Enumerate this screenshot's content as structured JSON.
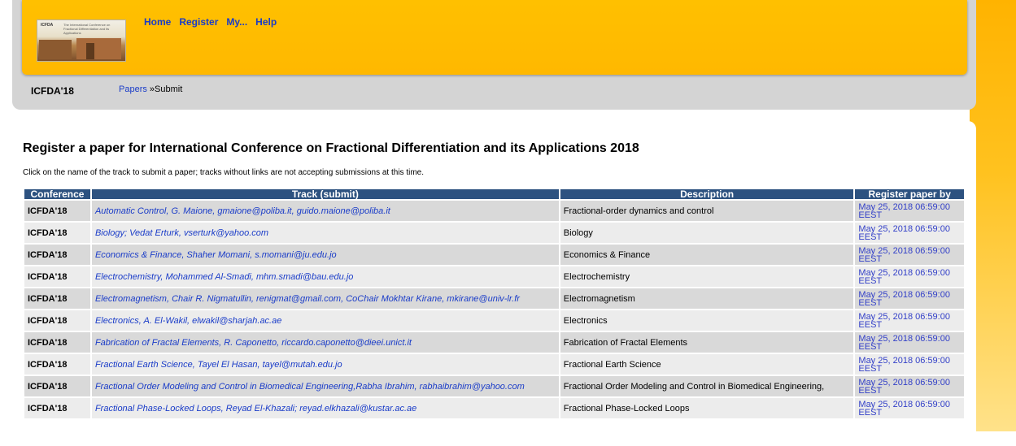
{
  "nav": {
    "items": [
      "Home",
      "Register",
      "My...",
      "Help"
    ]
  },
  "logo": {
    "mini_text": "ICFDA",
    "mini_subtext": "The International Conference on Fractional Differentiation and its Applications"
  },
  "conference": {
    "short_name": "ICFDA'18"
  },
  "breadcrumb": {
    "link": "Papers",
    "separator": " »",
    "current": "Submit"
  },
  "page": {
    "title": "Register a paper for International Conference on Fractional Differentiation and its Applications 2018",
    "instructions": "Click on the name of the track to submit a paper; tracks without links are not accepting submissions at this time."
  },
  "table": {
    "headers": [
      "Conference",
      "Track (submit)",
      "Description",
      "Register paper by"
    ],
    "rows": [
      {
        "conference": "ICFDA'18",
        "track": "Automatic Control, G. Maione, gmaione@poliba.it, guido.maione@poliba.it",
        "description": "Fractional-order dynamics and control",
        "deadline": "May 25, 2018 06:59:00 EEST"
      },
      {
        "conference": "ICFDA'18",
        "track": "Biology; Vedat Erturk, vserturk@yahoo.com",
        "description": "Biology",
        "deadline": "May 25, 2018 06:59:00 EEST"
      },
      {
        "conference": "ICFDA'18",
        "track": "Economics & Finance, Shaher Momani, s.momani@ju.edu.jo",
        "description": "Economics & Finance",
        "deadline": "May 25, 2018 06:59:00 EEST"
      },
      {
        "conference": "ICFDA'18",
        "track": "Electrochemistry, Mohammed Al-Smadi, mhm.smadi@bau.edu.jo",
        "description": "Electrochemistry",
        "deadline": "May 25, 2018 06:59:00 EEST"
      },
      {
        "conference": "ICFDA'18",
        "track": "Electromagnetism, Chair R. Nigmatullin, renigmat@gmail.com, CoChair Mokhtar Kirane, mkirane@univ-lr.fr",
        "description": "Electromagnetism",
        "deadline": "May 25, 2018 06:59:00 EEST"
      },
      {
        "conference": "ICFDA'18",
        "track": "Electronics, A. El-Wakil, elwakil@sharjah.ac.ae",
        "description": "Electronics",
        "deadline": "May 25, 2018 06:59:00 EEST"
      },
      {
        "conference": "ICFDA'18",
        "track": "Fabrication of Fractal Elements, R. Caponetto, riccardo.caponetto@dieei.unict.it",
        "description": "Fabrication of Fractal Elements",
        "deadline": "May 25, 2018 06:59:00 EEST"
      },
      {
        "conference": "ICFDA'18",
        "track": "Fractional Earth Science, Tayel El Hasan, tayel@mutah.edu.jo",
        "description": "Fractional Earth Science",
        "deadline": "May 25, 2018 06:59:00 EEST"
      },
      {
        "conference": "ICFDA'18",
        "track": "Fractional Order Modeling and Control in Biomedical Engineering,Rabha Ibrahim, rabhaibrahim@yahoo.com",
        "description": "Fractional Order Modeling and Control in Biomedical Engineering,",
        "deadline": "May 25, 2018 06:59:00 EEST"
      },
      {
        "conference": "ICFDA'18",
        "track": "Fractional Phase-Locked Loops, Reyad El-Khazali; reyad.elkhazali@kustar.ac.ae",
        "description": "Fractional Phase-Locked Loops",
        "deadline": "May 25, 2018 06:59:00 EEST"
      }
    ]
  },
  "colors": {
    "header_yellow": "#ffc000",
    "table_header": "#2d5280",
    "link_blue": "#1a3cc8"
  }
}
